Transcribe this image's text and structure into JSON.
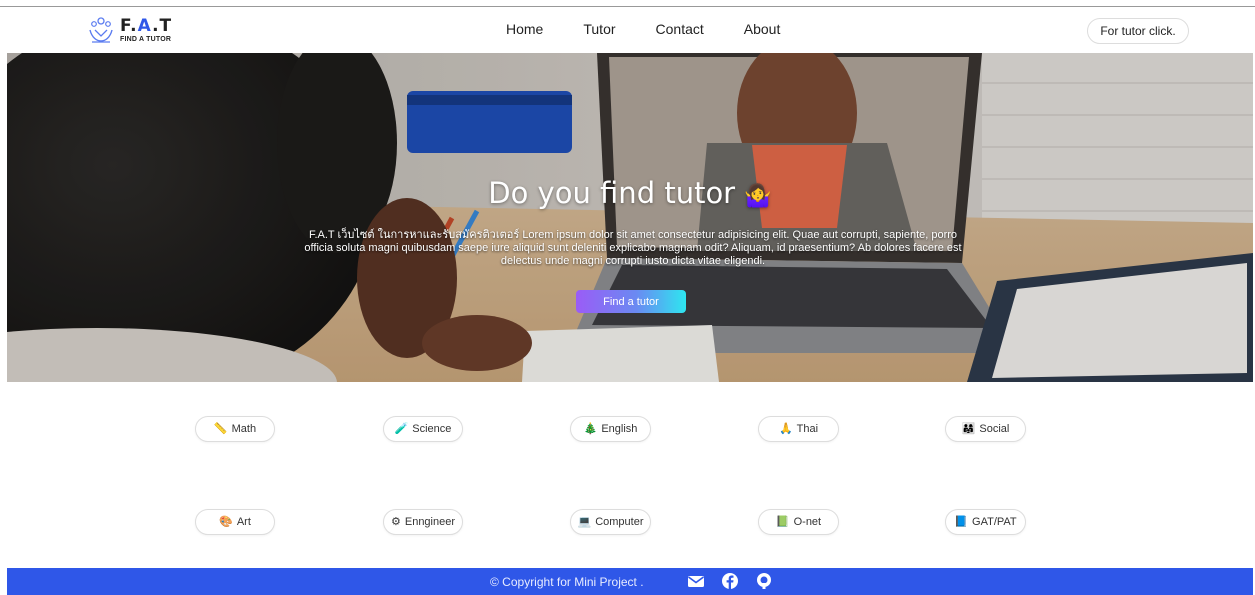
{
  "logo": {
    "title_prefix": "F.",
    "title_accent": "A",
    "title_suffix": ".T",
    "subtitle": "FIND A TUTOR",
    "icon": "logo-icon"
  },
  "nav": {
    "links": [
      "Home",
      "Tutor",
      "Contact",
      "About"
    ],
    "tutor_button": "For tutor click."
  },
  "hero": {
    "title": "Do you find tutor",
    "title_emoji": "🤷‍♀️",
    "text": "F.A.T เว็บไซต์ ในการหาและรับสมัครติวเตอร์ Lorem ipsum dolor sit amet consectetur adipisicing elit. Quae aut corrupti, sapiente, porro officia soluta magni quibusdam saepe iure aliquid sunt deleniti explicabo magnam odit? Aliquam, id praesentium? Ab dolores facere est delectus unde magni corrupti iusto dicta vitae eligendi.",
    "button": "Find a tutor"
  },
  "categories": [
    {
      "icon": "📏",
      "label": "Math"
    },
    {
      "icon": "🧪",
      "label": "Science"
    },
    {
      "icon": "🎄",
      "label": "English"
    },
    {
      "icon": "🙏",
      "label": "Thai"
    },
    {
      "icon": "👨‍👩‍👧",
      "label": "Social"
    },
    {
      "icon": "🎨",
      "label": "Art"
    },
    {
      "icon": "⚙",
      "label": "Enngineer"
    },
    {
      "icon": "💻",
      "label": "Computer"
    },
    {
      "icon": "📗",
      "label": "O-net"
    },
    {
      "icon": "📘",
      "label": "GAT/PAT"
    }
  ],
  "footer": {
    "copyright": "© Copyright for Mini Project .",
    "icons": [
      "mail-icon",
      "facebook-icon",
      "github-icon"
    ]
  },
  "colors": {
    "brand": "#2f57e8",
    "button_gradient_start": "#9b5cf6",
    "button_gradient_end": "#2ee6f0"
  }
}
